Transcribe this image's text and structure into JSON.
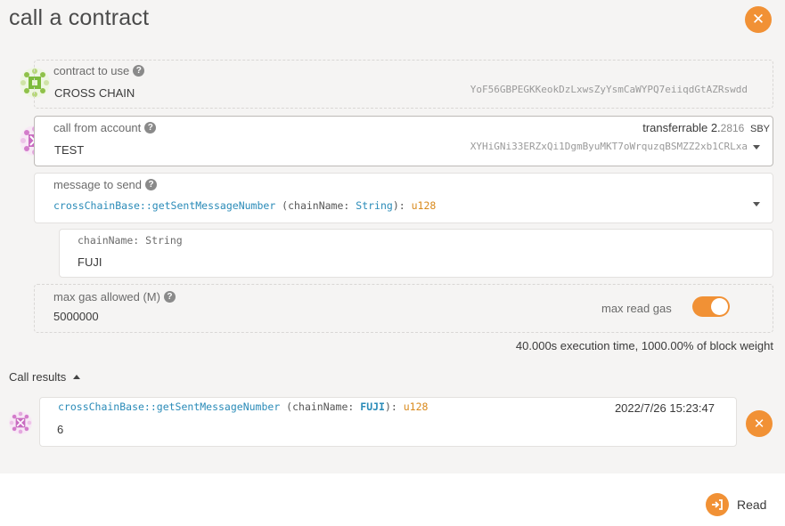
{
  "header": {
    "title": "call a contract",
    "close_icon": "close-icon"
  },
  "contract": {
    "label": "contract to use",
    "name": "CROSS CHAIN",
    "address": "YoF56GBPEGKKeokDzLxwsZyYsmCaWYPQ7eiiqdGtAZRswdd"
  },
  "account": {
    "label": "call from account",
    "name": "TEST",
    "address": "XYHiGNi33ERZxQi1DgmByuMKT7oWrquzqBSMZZ2xb1CRLxa",
    "transferrable_label": "transferrable",
    "balance_int": "2.",
    "balance_dec": "2816",
    "balance_unit": "SBY"
  },
  "message": {
    "label": "message to send",
    "fn": "crossChainBase::getSentMessageNumber",
    "param_open": " (chainName: ",
    "param_type": "String",
    "param_close": "): ",
    "return_type": "u128"
  },
  "param": {
    "label": "chainName: String",
    "value": "FUJI"
  },
  "gas": {
    "label": "max gas allowed (M)",
    "value": "5000000",
    "toggle_label": "max read gas",
    "toggle_on": true
  },
  "execution_info": "40.000s execution time, 1000.00% of block weight",
  "results": {
    "title": "Call results",
    "item": {
      "fn": "crossChainBase::getSentMessageNumber",
      "param_open": " (chainName: ",
      "param_value": "FUJI",
      "param_close": "): ",
      "return_type": "u128",
      "timestamp": "2022/7/26 15:23:47",
      "value": "6"
    }
  },
  "footer": {
    "read_label": "Read"
  },
  "colors": {
    "accent": "#f19135",
    "code_blue": "#2a8bb8",
    "code_orange": "#d98a1d"
  }
}
